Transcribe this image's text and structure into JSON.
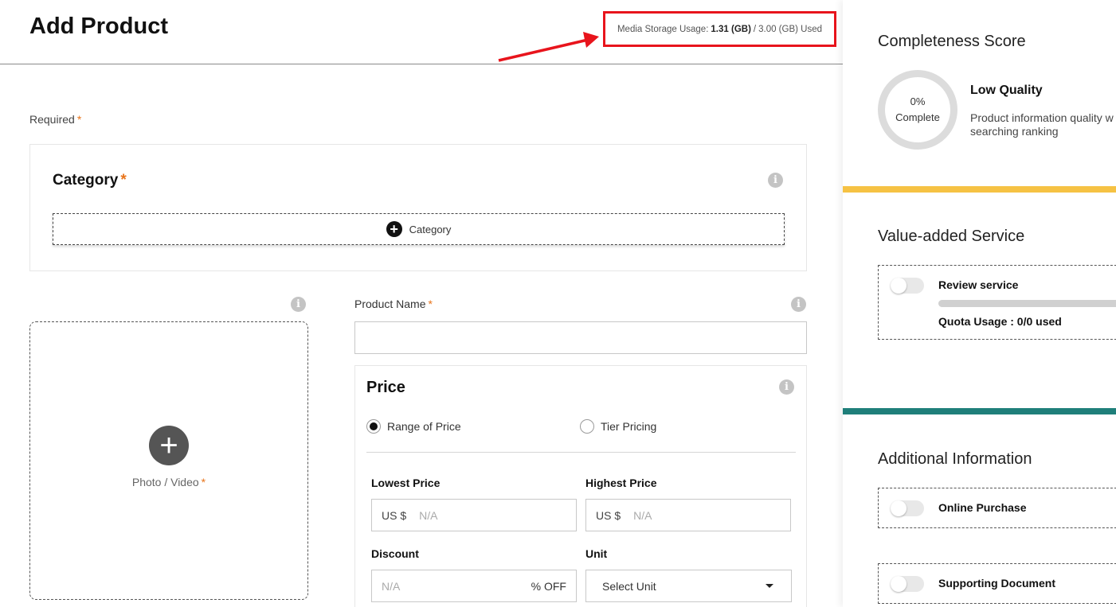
{
  "header": {
    "title": "Add Product",
    "storage": {
      "label": "Media Storage Usage:",
      "used": "1.31 (GB)",
      "separator": "/",
      "total": "3.00 (GB) Used"
    }
  },
  "form": {
    "required_label": "Required",
    "required_mark": "*",
    "category": {
      "title": "Category",
      "add_label": "Category"
    },
    "media": {
      "label": "Photo / Video"
    },
    "product_name": {
      "label": "Product Name",
      "value": ""
    },
    "price": {
      "title": "Price",
      "options": [
        {
          "label": "Range of Price",
          "selected": true
        },
        {
          "label": "Tier Pricing",
          "selected": false
        }
      ],
      "lowest": {
        "label": "Lowest Price",
        "prefix": "US $",
        "placeholder": "N/A"
      },
      "highest": {
        "label": "Highest Price",
        "prefix": "US $",
        "placeholder": "N/A"
      },
      "discount": {
        "label": "Discount",
        "placeholder": "N/A",
        "suffix": "% OFF"
      },
      "unit": {
        "label": "Unit",
        "selected": "Select Unit"
      }
    }
  },
  "sidebar": {
    "completeness": {
      "heading": "Completeness Score",
      "percent": "0%",
      "complete_label": "Complete",
      "quality_title": "Low Quality",
      "quality_desc_line1": "Product information quality w",
      "quality_desc_line2": "searching ranking"
    },
    "value_added": {
      "heading": "Value-added Service",
      "review_label": "Review service",
      "review_enabled": false,
      "quota_label": "Quota Usage : 0/0 used",
      "quota_fraction": 0
    },
    "additional": {
      "heading": "Additional Information",
      "online_purchase_label": "Online Purchase",
      "online_purchase_enabled": false,
      "supporting_doc_label": "Supporting Document",
      "supporting_doc_enabled": false
    }
  },
  "colors": {
    "annotation_red": "#e8141c",
    "required_orange": "#e8741a",
    "band_yellow": "#f6c244",
    "band_teal": "#1f7f7a"
  },
  "icons": {
    "info": "info-icon",
    "add": "plus-circle-icon",
    "dropdown": "caret-down-icon"
  }
}
